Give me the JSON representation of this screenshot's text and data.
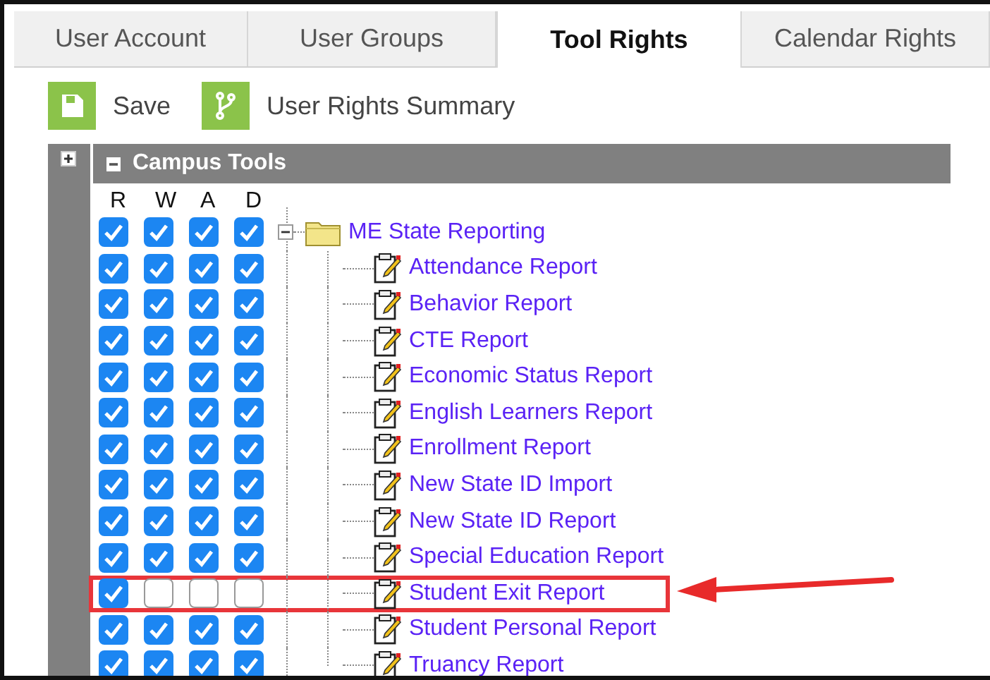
{
  "tabs": [
    {
      "label": "User Account",
      "selected": false
    },
    {
      "label": "User Groups",
      "selected": false
    },
    {
      "label": "Tool Rights",
      "selected": true
    },
    {
      "label": "Calendar Rights",
      "selected": false
    }
  ],
  "toolbar": [
    {
      "label": "Save",
      "kind": "save"
    },
    {
      "label": "User Rights Summary",
      "kind": "summary"
    }
  ],
  "panel": {
    "title": "Campus Tools",
    "expanded": true
  },
  "rights_columns": [
    "R",
    "W",
    "A",
    "D"
  ],
  "tree": {
    "label": "ME State Reporting",
    "expanded": true,
    "highlighted": false,
    "rights": [
      true,
      true,
      true,
      true
    ],
    "children": [
      {
        "label": "Attendance Report",
        "highlighted": false,
        "rights": [
          true,
          true,
          true,
          true
        ]
      },
      {
        "label": "Behavior Report",
        "highlighted": false,
        "rights": [
          true,
          true,
          true,
          true
        ]
      },
      {
        "label": "CTE Report",
        "highlighted": false,
        "rights": [
          true,
          true,
          true,
          true
        ]
      },
      {
        "label": "Economic Status Report",
        "highlighted": false,
        "rights": [
          true,
          true,
          true,
          true
        ]
      },
      {
        "label": "English Learners Report",
        "highlighted": false,
        "rights": [
          true,
          true,
          true,
          true
        ]
      },
      {
        "label": "Enrollment Report",
        "highlighted": false,
        "rights": [
          true,
          true,
          true,
          true
        ]
      },
      {
        "label": "New State ID Import",
        "highlighted": false,
        "rights": [
          true,
          true,
          true,
          true
        ]
      },
      {
        "label": "New State ID Report",
        "highlighted": false,
        "rights": [
          true,
          true,
          true,
          true
        ]
      },
      {
        "label": "Special Education Report",
        "highlighted": false,
        "rights": [
          true,
          true,
          true,
          true
        ]
      },
      {
        "label": "Student Exit Report",
        "highlighted": true,
        "rights": [
          true,
          false,
          false,
          false
        ]
      },
      {
        "label": "Student Personal Report",
        "highlighted": false,
        "rights": [
          true,
          true,
          true,
          true
        ]
      },
      {
        "label": "Truancy Report",
        "highlighted": false,
        "rights": [
          true,
          true,
          true,
          true
        ]
      }
    ]
  }
}
